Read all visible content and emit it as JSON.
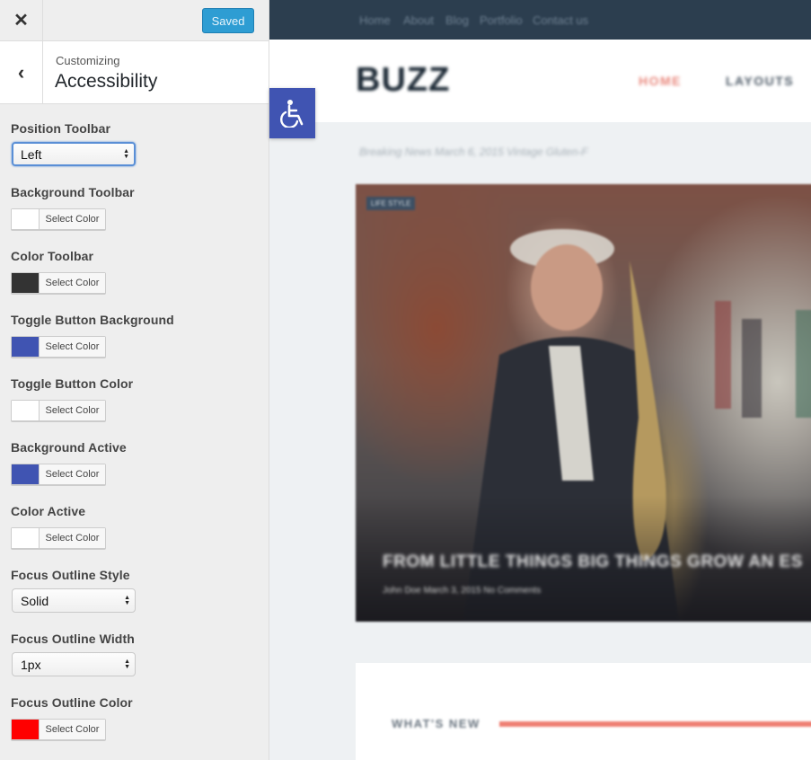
{
  "customizer": {
    "saved_label": "Saved",
    "breadcrumb": "Customizing",
    "section_title": "Accessibility",
    "controls": {
      "position_toolbar": {
        "label": "Position Toolbar",
        "value": "Left"
      },
      "background_toolbar": {
        "label": "Background Toolbar",
        "button": "Select Color",
        "color": "#ffffff"
      },
      "color_toolbar": {
        "label": "Color Toolbar",
        "button": "Select Color",
        "color": "#333333"
      },
      "toggle_button_background": {
        "label": "Toggle Button Background",
        "button": "Select Color",
        "color": "#4054b2"
      },
      "toggle_button_color": {
        "label": "Toggle Button Color",
        "button": "Select Color",
        "color": "#ffffff"
      },
      "background_active": {
        "label": "Background Active",
        "button": "Select Color",
        "color": "#4054b2"
      },
      "color_active": {
        "label": "Color Active",
        "button": "Select Color",
        "color": "#ffffff"
      },
      "focus_outline_style": {
        "label": "Focus Outline Style",
        "value": "Solid"
      },
      "focus_outline_width": {
        "label": "Focus Outline Width",
        "value": "1px"
      },
      "focus_outline_color": {
        "label": "Focus Outline Color",
        "button": "Select Color",
        "color": "#ff0000"
      }
    }
  },
  "preview": {
    "nav_links": [
      "Home",
      "About",
      "Blog",
      "Portfolio",
      "Contact us"
    ],
    "logo": "BUZZ",
    "menu": {
      "home": "HOME",
      "layouts": "LAYOUTS"
    },
    "breaking": "Breaking News  March 6, 2015 Vintage Gluten-F",
    "hero": {
      "tag": "LIFE STYLE",
      "title": "FROM LITTLE THINGS BIG THINGS GROW AN ES",
      "meta": "John Doe  March 3, 2015  No Comments"
    },
    "whats_new": "WHAT'S NEW"
  },
  "icons": {
    "close": "close-icon",
    "back": "chevron-left-icon",
    "toggle": "wheelchair-icon",
    "select_arrows": "select-arrows-icon"
  },
  "colors": {
    "accent_button": "#2e9dd3",
    "toggle_bg": "#4054b2",
    "site_topnav": "#2c3e4f"
  }
}
